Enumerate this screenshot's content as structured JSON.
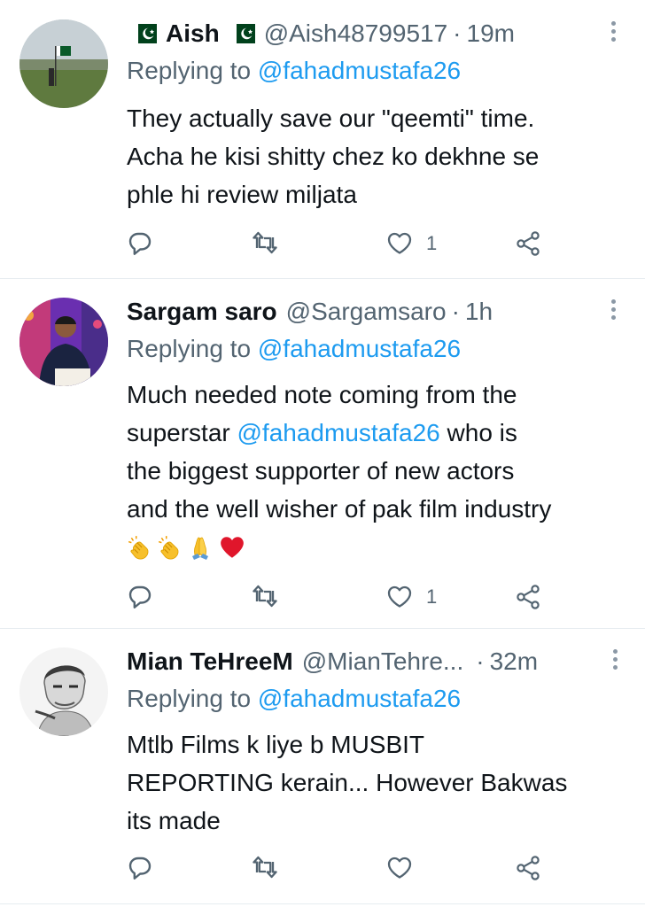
{
  "replying_prefix": "Replying to",
  "tweets": [
    {
      "name": "Aish",
      "handle": "@Aish48799517",
      "separator": "·",
      "time": "19m",
      "reply_to": "@fahadmustafa26",
      "text_lines": [
        "They actually save our \"qeemti\" time.",
        "Acha he kisi shitty chez ko dekhne se",
        "phle hi review miljata"
      ],
      "like_count": "1",
      "flag_icon": "pakistan-flag-icon"
    },
    {
      "name": "Sargam saro",
      "handle": "@Sargamsaro",
      "separator": "·",
      "time": "1h",
      "reply_to": "@fahadmustafa26",
      "line1": "Much needed note coming from the",
      "line2_pre": "superstar ",
      "line2_mention": "@fahadmustafa26",
      "line2_post": " who is",
      "line3": "the biggest supporter of new actors",
      "line4": "and the well wisher of pak film industry",
      "emojis": [
        "clapping-hands-emoji",
        "clapping-hands-emoji",
        "folded-hands-emoji",
        "red-heart-emoji"
      ],
      "like_count": "1"
    },
    {
      "name": "Mian TeHreeM",
      "handle": "@MianTehre...",
      "separator": "·",
      "time": "32m",
      "reply_to": "@fahadmustafa26",
      "text_lines": [
        "Mtlb Films k liye b MUSBIT",
        "REPORTING kerain... However Bakwas",
        "its made"
      ],
      "like_count": ""
    }
  ],
  "colors": {
    "link": "#1d9bf0",
    "muted": "#536471",
    "text": "#0f1419",
    "divider": "#e6ecf0"
  }
}
